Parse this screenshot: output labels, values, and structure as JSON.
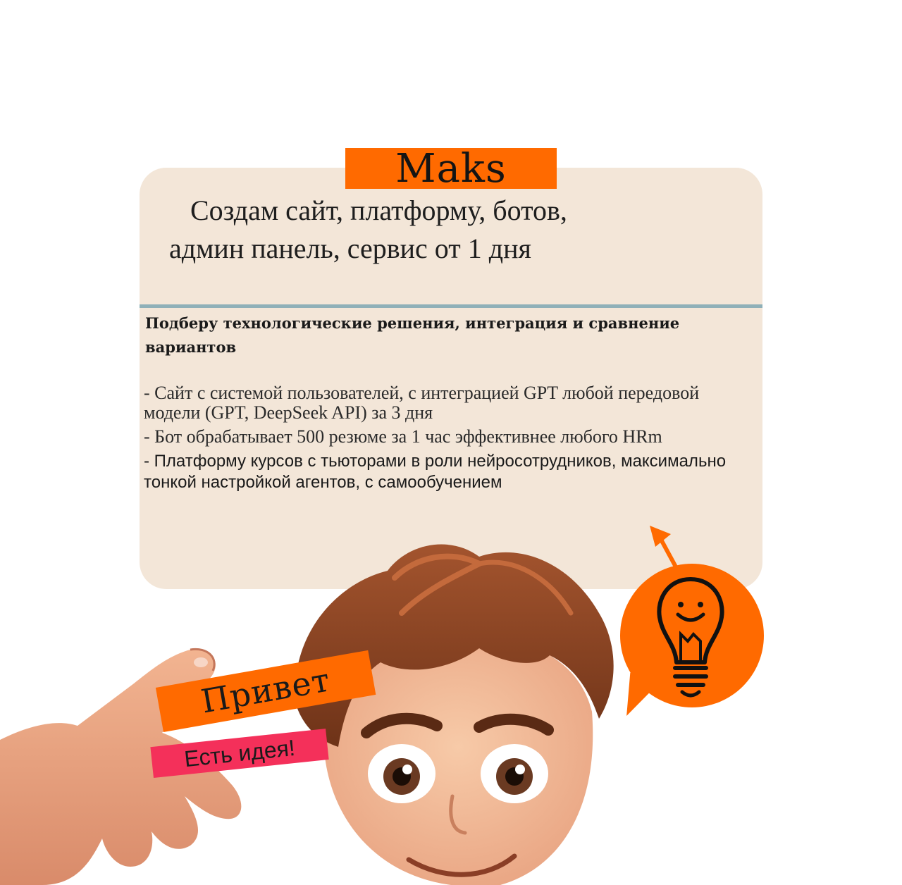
{
  "name_tag": "Maks",
  "headline": {
    "line1": "Создам сайт, платформу, ботов,",
    "line2": "админ панель, сервис от 1 дня"
  },
  "subheading": "Подберу технологические решения, интеграция и сравнение вариантов",
  "items": [
    "- Сайт с системой пользователей, с интеграцией GPT любой передовой модели (GPT, DeepSeek API) за 3 дня",
    "- Бот обрабатывает 500 резюме за 1 час эффективнее любого HRm",
    "- Платформу курсов с тьюторами в роли нейросотрудников, максимально тонкой настройкой агентов, с самообучением"
  ],
  "stickers": {
    "greeting": "Привет",
    "idea": "Есть идея!"
  },
  "icons": {
    "bulb": "lightbulb-smile-icon",
    "arrow": "arrow-up-icon"
  },
  "colors": {
    "accent_orange": "#ff6a00",
    "card_bg": "#f3e6d8",
    "divider": "#8fb0b8",
    "idea_pink": "#f4305a"
  }
}
